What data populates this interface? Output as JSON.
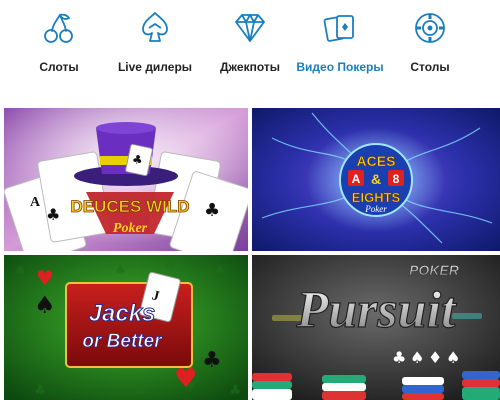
{
  "nav": {
    "items": [
      {
        "label": "Слоты",
        "icon": "cherries-icon",
        "active": false
      },
      {
        "label": "Live дилеры",
        "icon": "chips-icon",
        "active": false
      },
      {
        "label": "Джекпоты",
        "icon": "diamond-icon",
        "active": false
      },
      {
        "label": "Видео Покеры",
        "icon": "cards-icon",
        "active": true
      },
      {
        "label": "Столы",
        "icon": "chip-icon",
        "active": false
      }
    ],
    "accent": "#1a7fc0"
  },
  "games": [
    {
      "logo_line1": "DEUCES WILD",
      "logo_line2": "Poker"
    },
    {
      "logo_line1": "ACES",
      "logo_mid_left": "A",
      "logo_mid_and": "&",
      "logo_mid_right": "8",
      "logo_line2": "EIGHTS",
      "logo_line3": "Poker"
    },
    {
      "logo_line1": "Jacks",
      "logo_line2": "or Better"
    },
    {
      "logo_line1": "POKER",
      "logo_line2": "Pursuit"
    }
  ]
}
